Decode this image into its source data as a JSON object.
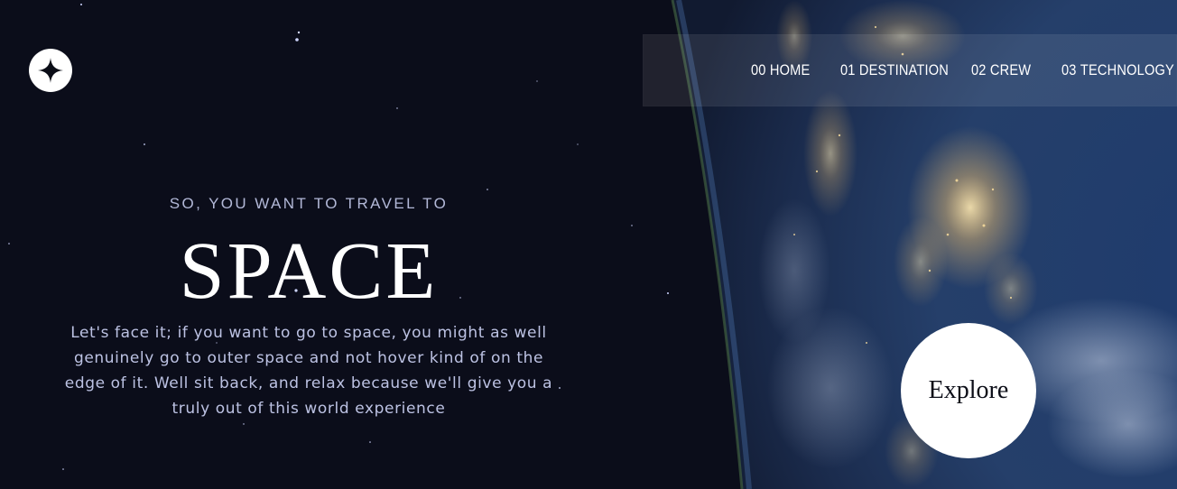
{
  "logo": {
    "icon": "star-icon",
    "color": "#ffffff"
  },
  "nav": {
    "items": [
      {
        "number": "00",
        "label": "HOME"
      },
      {
        "number": "01",
        "label": "DESTINATION"
      },
      {
        "number": "02",
        "label": "CREW"
      },
      {
        "number": "03",
        "label": "TECHNOLOGY"
      }
    ]
  },
  "hero": {
    "kicker": "SO, YOU WANT TO TRAVEL TO",
    "title": "SPACE",
    "body": "Let's face it; if you want to go to space, you might as well genuinely go to outer space and not hover kind of on the edge of it. Well sit back, and relax because we'll give you a truly out of this world experience"
  },
  "explore": {
    "label": "Explore"
  },
  "colors": {
    "background": "#0b0d17",
    "text_light": "#d0d6f9",
    "white": "#ffffff"
  }
}
